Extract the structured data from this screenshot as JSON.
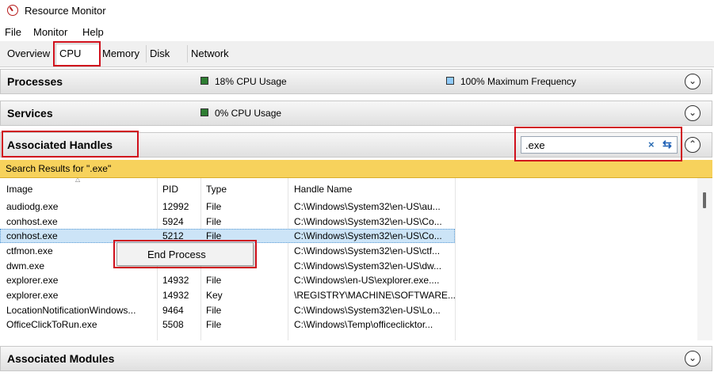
{
  "window": {
    "title": "Resource Monitor"
  },
  "menu": [
    "File",
    "Monitor",
    "Help"
  ],
  "tabs": [
    "Overview",
    "CPU",
    "Memory",
    "Disk",
    "Network"
  ],
  "panels": {
    "processes": {
      "title": "Processes",
      "cpu_usage": "18% CPU Usage",
      "max_frequency": "100% Maximum Frequency"
    },
    "services": {
      "title": "Services",
      "cpu_usage": "0% CPU Usage"
    },
    "handles": {
      "title": "Associated Handles",
      "search_value": ".exe",
      "results_label": "Search Results for \".exe\""
    },
    "modules": {
      "title": "Associated Modules"
    }
  },
  "table": {
    "columns": [
      "Image",
      "PID",
      "Type",
      "Handle Name"
    ],
    "rows": [
      [
        "audiodg.exe",
        "12992",
        "File",
        "C:\\Windows\\System32\\en-US\\au..."
      ],
      [
        "conhost.exe",
        "5924",
        "File",
        "C:\\Windows\\System32\\en-US\\Co..."
      ],
      [
        "conhost.exe",
        "5212",
        "File",
        "C:\\Windows\\System32\\en-US\\Co..."
      ],
      [
        "ctfmon.exe",
        "",
        "",
        "C:\\Windows\\System32\\en-US\\ctf..."
      ],
      [
        "dwm.exe",
        "",
        "",
        "C:\\Windows\\System32\\en-US\\dw..."
      ],
      [
        "explorer.exe",
        "14932",
        "File",
        "C:\\Windows\\en-US\\explorer.exe...."
      ],
      [
        "explorer.exe",
        "14932",
        "Key",
        "\\REGISTRY\\MACHINE\\SOFTWARE..."
      ],
      [
        "LocationNotificationWindows...",
        "9464",
        "File",
        "C:\\Windows\\System32\\en-US\\Lo..."
      ],
      [
        "OfficeClickToRun.exe",
        "5508",
        "File",
        "C:\\Windows\\Temp\\officeclicktor..."
      ]
    ]
  },
  "context_menu": {
    "end_process": "End Process"
  },
  "colors": {
    "cpu_swatch": "#2e7d32",
    "freq_swatch": "#90caf9",
    "highlight": "#d0101c",
    "banner": "#f7d25c"
  },
  "icons": [
    "resource-monitor-icon",
    "clear-search-icon",
    "refresh-search-icon",
    "chevron-down-icon",
    "chevron-up-icon"
  ]
}
